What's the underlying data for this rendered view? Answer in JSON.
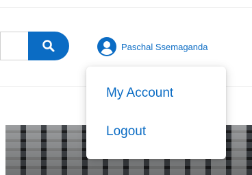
{
  "header": {
    "search": {
      "value": "",
      "placeholder": "",
      "button_icon": "search-icon"
    },
    "user": {
      "icon": "user-circle-icon",
      "name": "Paschal Ssemaganda"
    }
  },
  "user_menu": {
    "items": [
      {
        "label": "My Account"
      },
      {
        "label": "Logout"
      }
    ]
  },
  "colors": {
    "accent": "#0b6cc4",
    "divider": "#e6e6e6",
    "menu_background": "#ffffff"
  }
}
